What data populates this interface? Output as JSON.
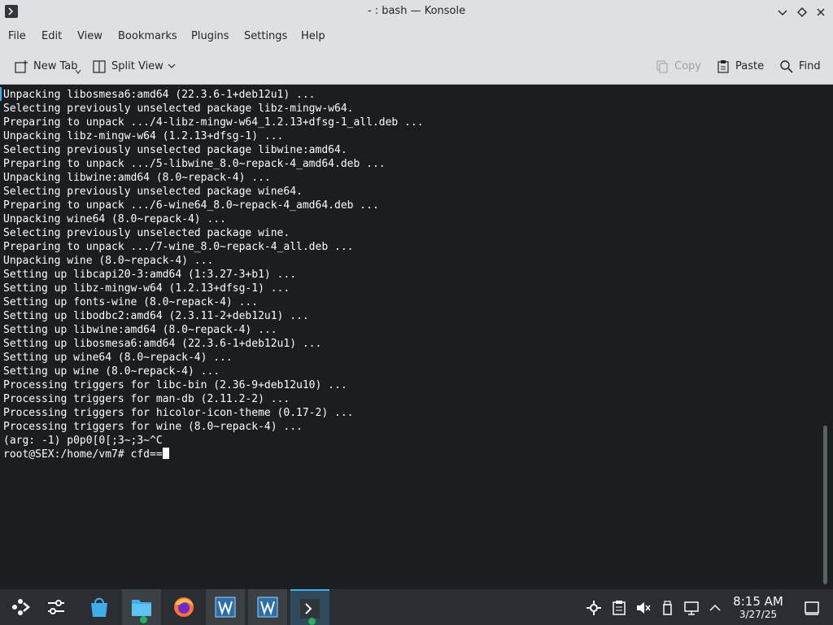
{
  "window": {
    "title": "- : bash — Konsole"
  },
  "menubar": {
    "items": [
      "File",
      "Edit",
      "View",
      "Bookmarks",
      "Plugins",
      "Settings",
      "Help"
    ]
  },
  "toolbar": {
    "new_tab": "New Tab",
    "split_view": "Split View",
    "copy": "Copy",
    "paste": "Paste",
    "find": "Find"
  },
  "terminal": {
    "lines": [
      "Unpacking libosmesa6:amd64 (22.3.6-1+deb12u1) ...",
      "Selecting previously unselected package libz-mingw-w64.",
      "Preparing to unpack .../4-libz-mingw-w64_1.2.13+dfsg-1_all.deb ...",
      "Unpacking libz-mingw-w64 (1.2.13+dfsg-1) ...",
      "Selecting previously unselected package libwine:amd64.",
      "Preparing to unpack .../5-libwine_8.0~repack-4_amd64.deb ...",
      "Unpacking libwine:amd64 (8.0~repack-4) ...",
      "Selecting previously unselected package wine64.",
      "Preparing to unpack .../6-wine64_8.0~repack-4_amd64.deb ...",
      "Unpacking wine64 (8.0~repack-4) ...",
      "Selecting previously unselected package wine.",
      "Preparing to unpack .../7-wine_8.0~repack-4_all.deb ...",
      "Unpacking wine (8.0~repack-4) ...",
      "Setting up libcapi20-3:amd64 (1:3.27-3+b1) ...",
      "Setting up libz-mingw-w64 (1.2.13+dfsg-1) ...",
      "Setting up fonts-wine (8.0~repack-4) ...",
      "Setting up libodbc2:amd64 (2.3.11-2+deb12u1) ...",
      "Setting up libwine:amd64 (8.0~repack-4) ...",
      "Setting up libosmesa6:amd64 (22.3.6-1+deb12u1) ...",
      "Setting up wine64 (8.0~repack-4) ...",
      "Setting up wine (8.0~repack-4) ...",
      "Processing triggers for libc-bin (2.36-9+deb12u10) ...",
      "Processing triggers for man-db (2.11.2-2) ...",
      "Processing triggers for hicolor-icon-theme (0.17-2) ...",
      "Processing triggers for wine (8.0~repack-4) ...",
      "(arg: -1) p0p0[0[;3~;3~^C"
    ],
    "prompt": "root@SEX:/home/vm7# cfd=="
  },
  "taskbar": {
    "icons": [
      "application-launcher-icon",
      "steam-settings-icon",
      "discover-store-icon",
      "file-manager-icon",
      "firefox-icon",
      "wine-app-icon",
      "wine-app-icon",
      "konsole-icon"
    ],
    "clock_time": "8:15 AM",
    "clock_date": "3/27/25"
  }
}
